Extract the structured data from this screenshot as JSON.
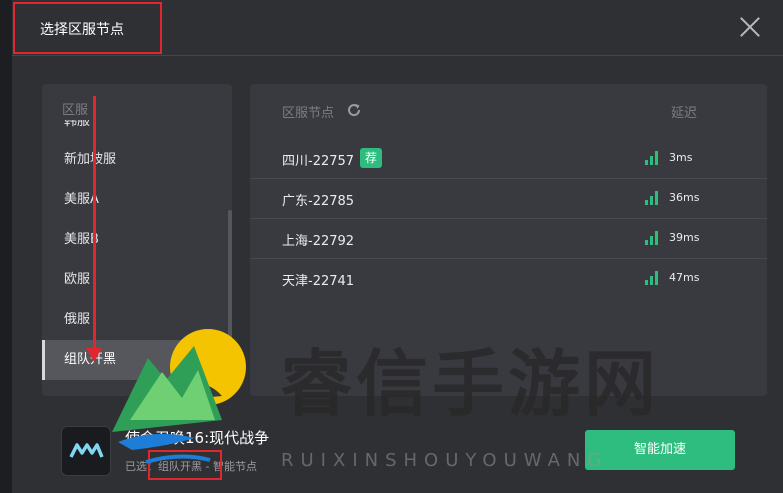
{
  "dialog": {
    "title": "选择区服节点"
  },
  "region_panel": {
    "header": "区服",
    "items": [
      {
        "label": "韩服"
      },
      {
        "label": "新加坡服"
      },
      {
        "label": "美服A"
      },
      {
        "label": "美服B"
      },
      {
        "label": "欧服"
      },
      {
        "label": "俄服"
      },
      {
        "label": "组队开黑"
      }
    ],
    "selected": "组队开黑"
  },
  "node_panel": {
    "header": "区服节点",
    "latency_header": "延迟",
    "rows": [
      {
        "name": "四川-22757",
        "badge": "荐",
        "latency": "3ms"
      },
      {
        "name": "广东-22785",
        "badge": "",
        "latency": "36ms"
      },
      {
        "name": "上海-22792",
        "badge": "",
        "latency": "39ms"
      },
      {
        "name": "天津-22741",
        "badge": "",
        "latency": "47ms"
      }
    ]
  },
  "footer": {
    "game_name": "使命召唤16:现代战争",
    "status": "已选：组队开黑 - 智能节点",
    "accelerate_label": "智能加速"
  },
  "watermark": {
    "text": "睿信手游网",
    "sub": "RUIXINSHOUYOUWANG"
  },
  "colors": {
    "accent": "#2ebd7e",
    "highlight": "#e0262e",
    "panel": "#393a3f",
    "background": "#2f3034"
  },
  "icons": {
    "close": "close-icon",
    "refresh": "refresh-icon",
    "signal": "signal-icon",
    "game_logo": "mw-logo-icon"
  }
}
